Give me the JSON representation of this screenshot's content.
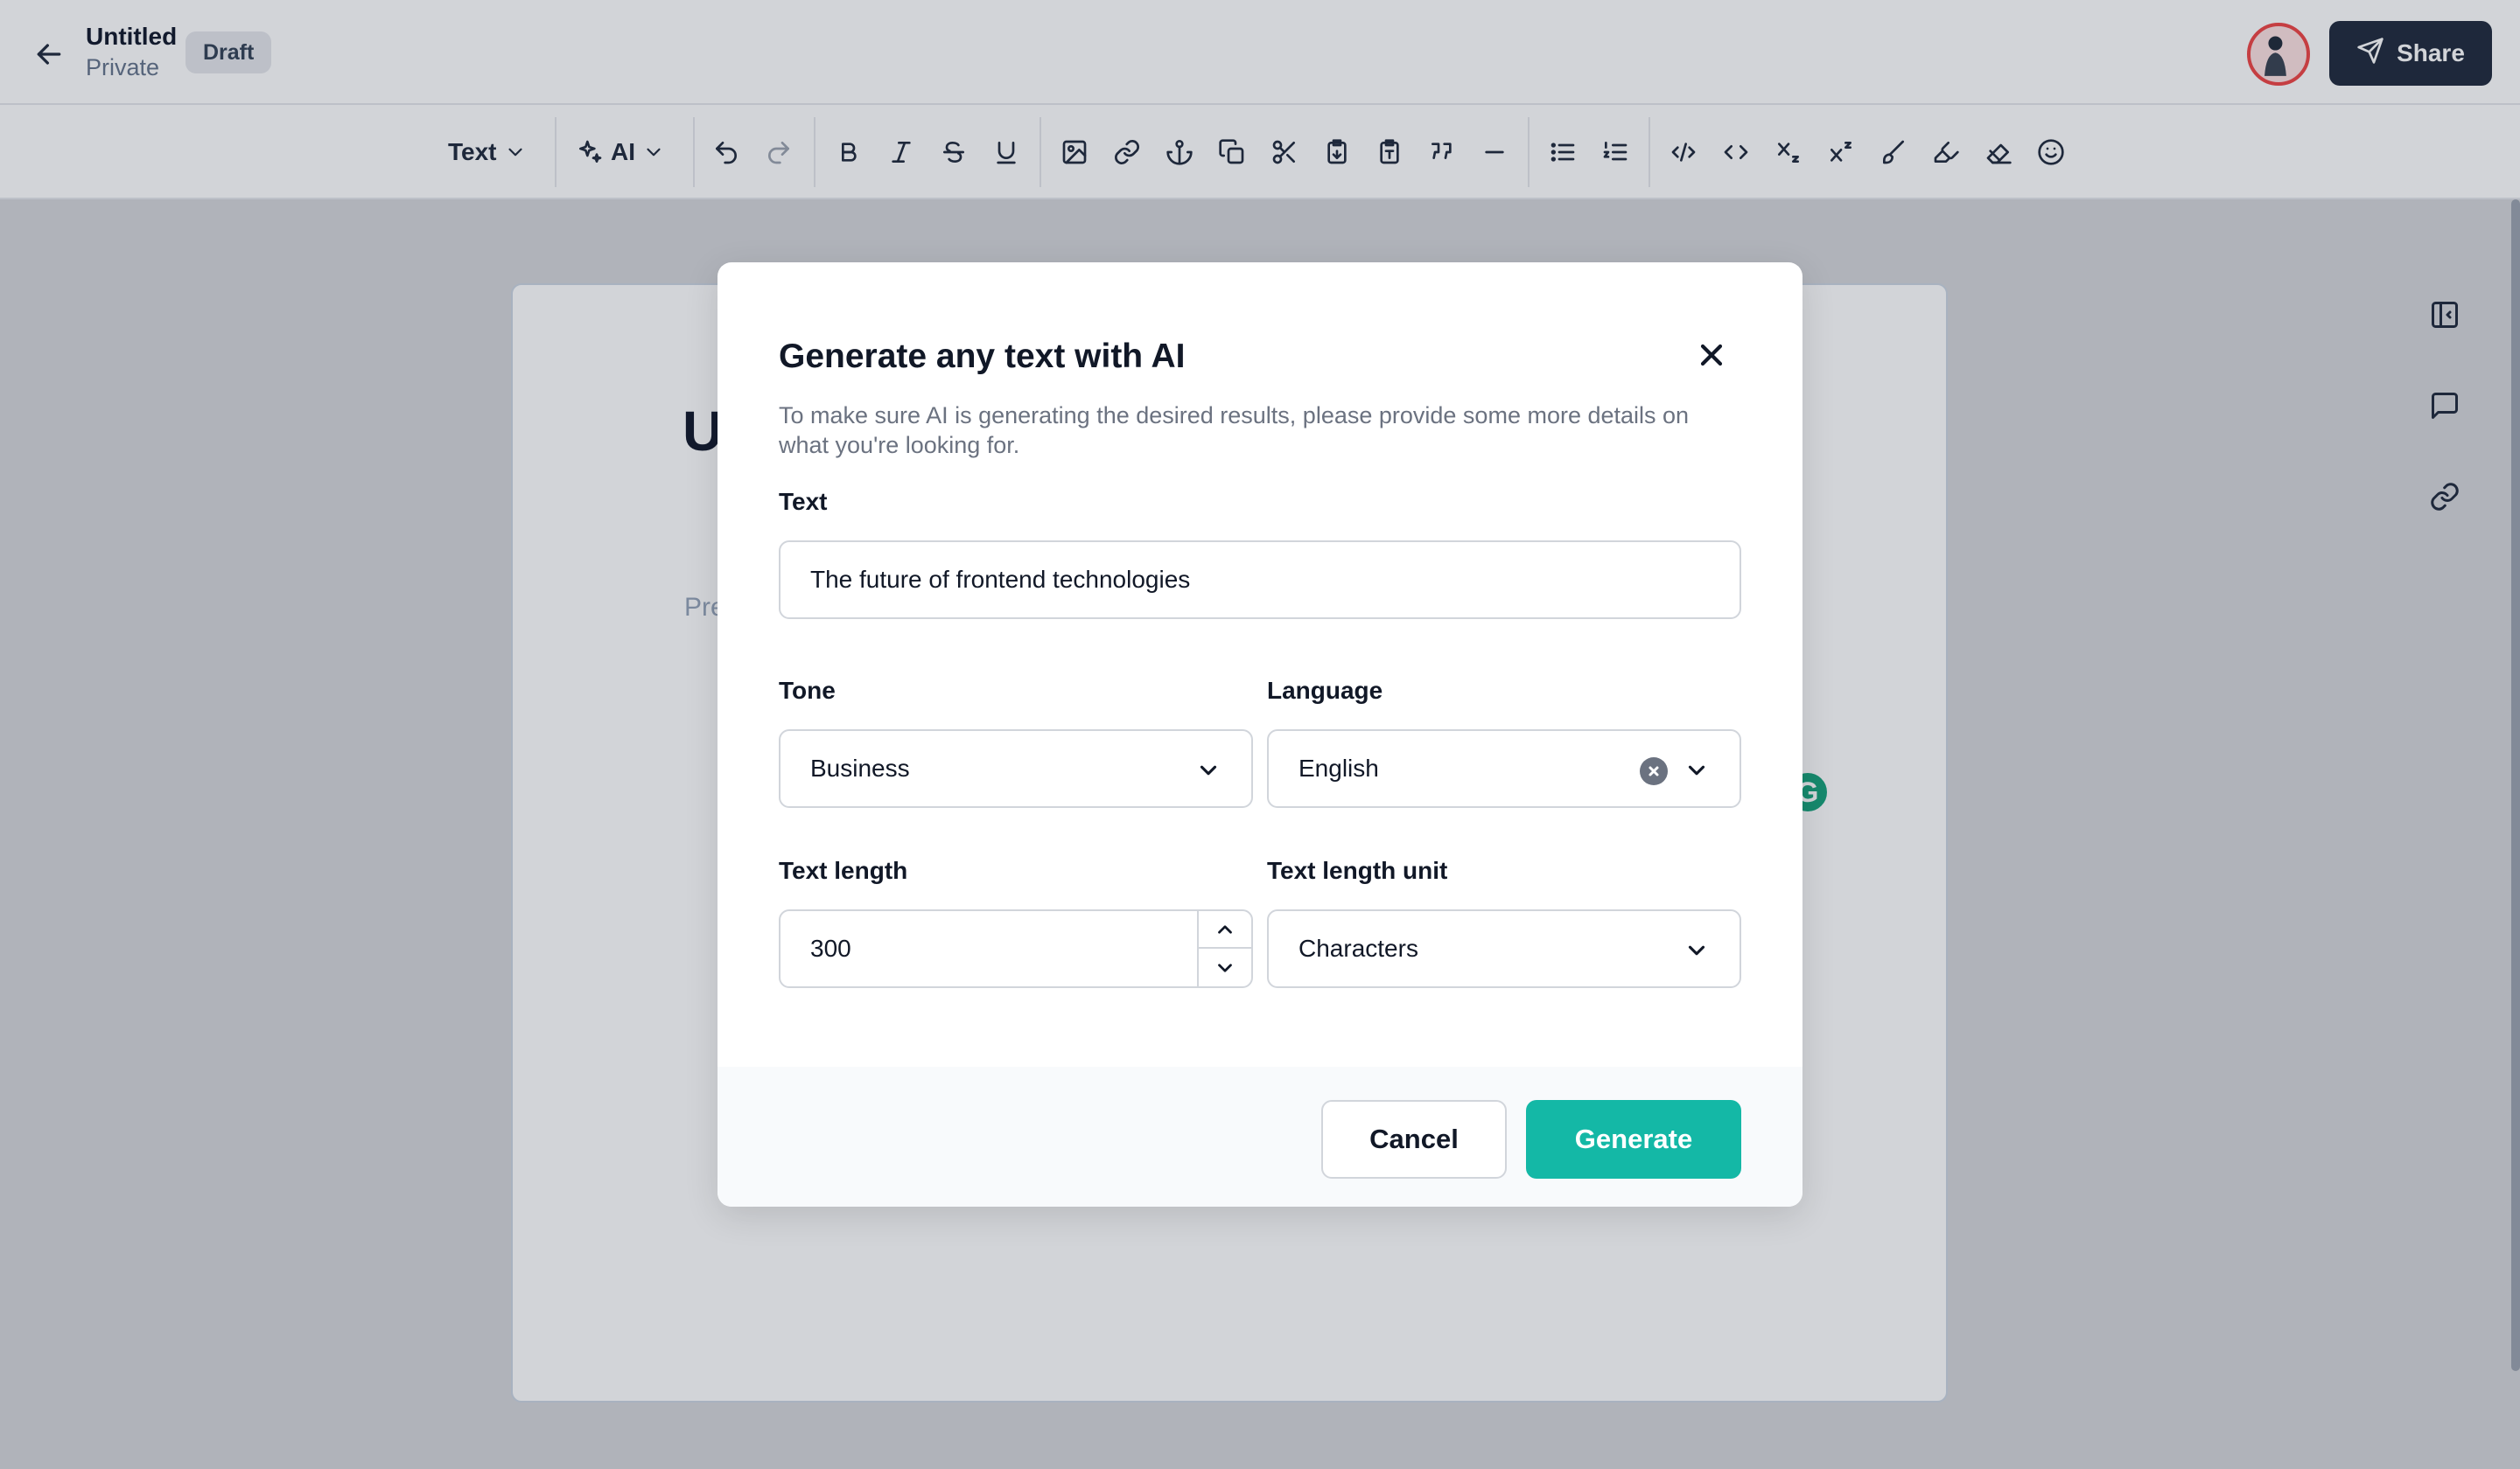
{
  "header": {
    "title": "Untitled",
    "privacy": "Private",
    "status_badge": "Draft",
    "share_label": "Share"
  },
  "toolbar": {
    "text_style_label": "Text",
    "ai_label": "AI"
  },
  "editor": {
    "heading_visible": "U",
    "placeholder_visible": "Pre"
  },
  "grammarly_label": "G",
  "modal": {
    "title": "Generate any text with AI",
    "description": "To make sure AI is generating the desired results, please provide some more details on what you're looking for.",
    "text_label": "Text",
    "text_value": "The future of frontend technologies",
    "tone_label": "Tone",
    "tone_value": "Business",
    "language_label": "Language",
    "language_value": "English",
    "length_label": "Text length",
    "length_value": "300",
    "unit_label": "Text length unit",
    "unit_value": "Characters",
    "cancel_label": "Cancel",
    "generate_label": "Generate"
  },
  "colors": {
    "accent": "#14b8a6",
    "share_button": "#1e293b",
    "avatar_ring": "#ef4444"
  }
}
